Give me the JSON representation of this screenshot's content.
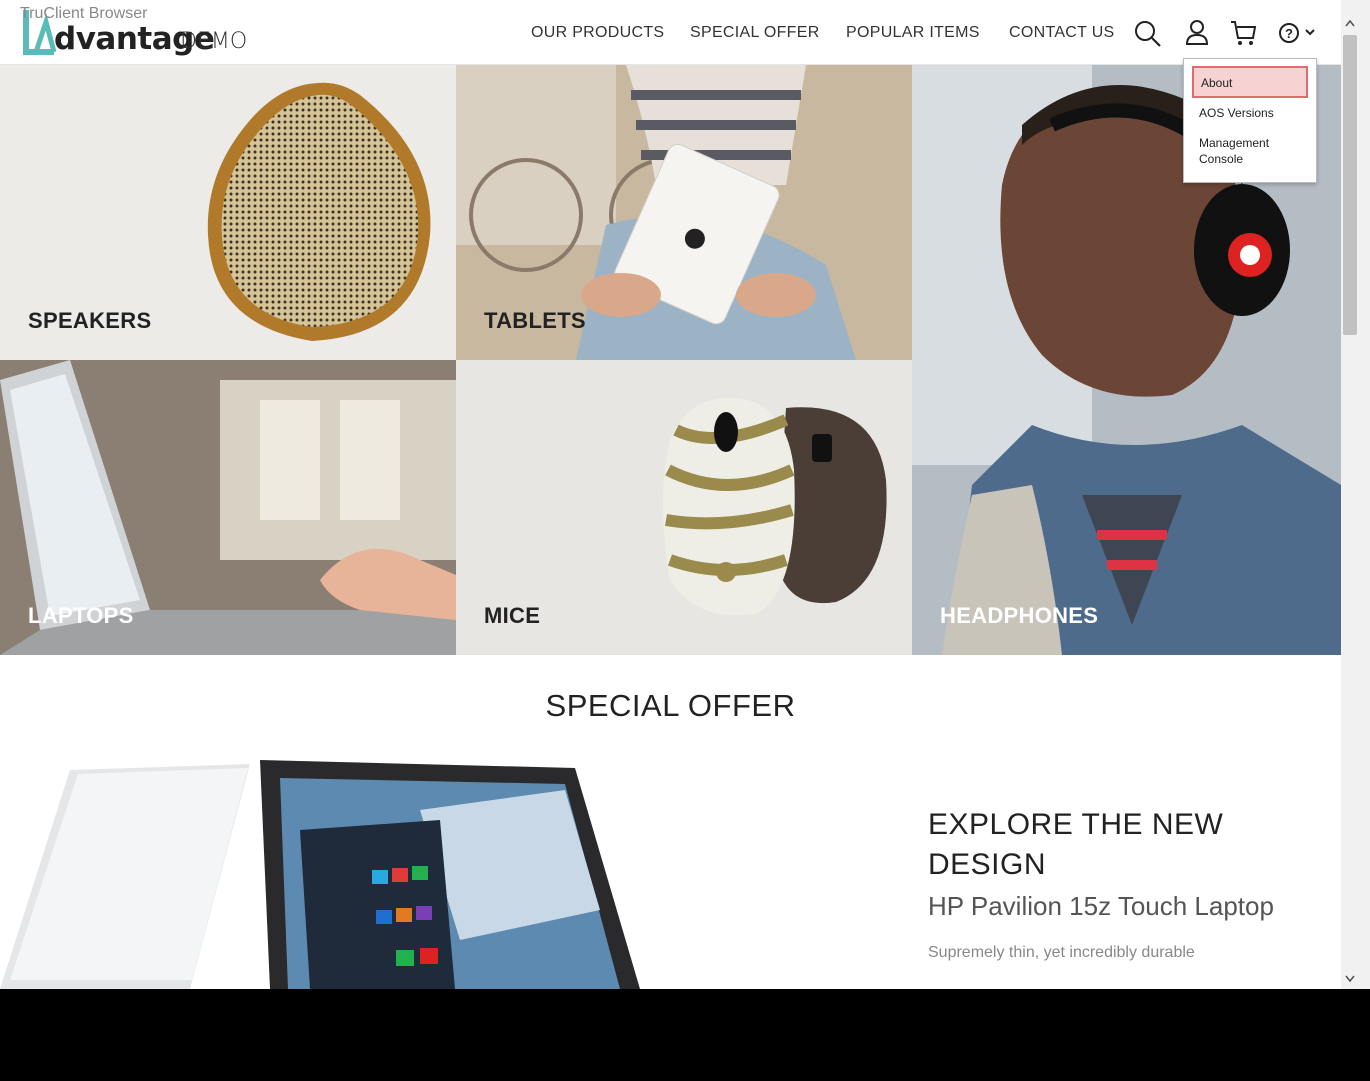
{
  "browser": {
    "label": "TruClient Browser"
  },
  "logo": {
    "brand": "dvantage",
    "suffix": "DEMO"
  },
  "nav": {
    "products": "OUR PRODUCTS",
    "special_offer": "SPECIAL OFFER",
    "popular_items": "POPULAR ITEMS",
    "contact_us": "CONTACT US"
  },
  "help_menu": {
    "items": [
      "About",
      "AOS Versions",
      "Management Console"
    ],
    "active": "About"
  },
  "categories": {
    "speakers": "SPEAKERS",
    "tablets": "TABLETS",
    "headphones": "HEADPHONES",
    "laptops": "LAPTOPS",
    "mice": "MICE"
  },
  "special_offer": {
    "section_title": "SPECIAL OFFER",
    "headline": "EXPLORE THE NEW DESIGN",
    "product": "HP Pavilion 15z Touch Laptop",
    "description": "Supremely thin, yet incredibly durable"
  },
  "colors": {
    "accent": "#5abcb9",
    "highlight_bg": "#f7d2d3",
    "highlight_border": "#e06b6d"
  }
}
